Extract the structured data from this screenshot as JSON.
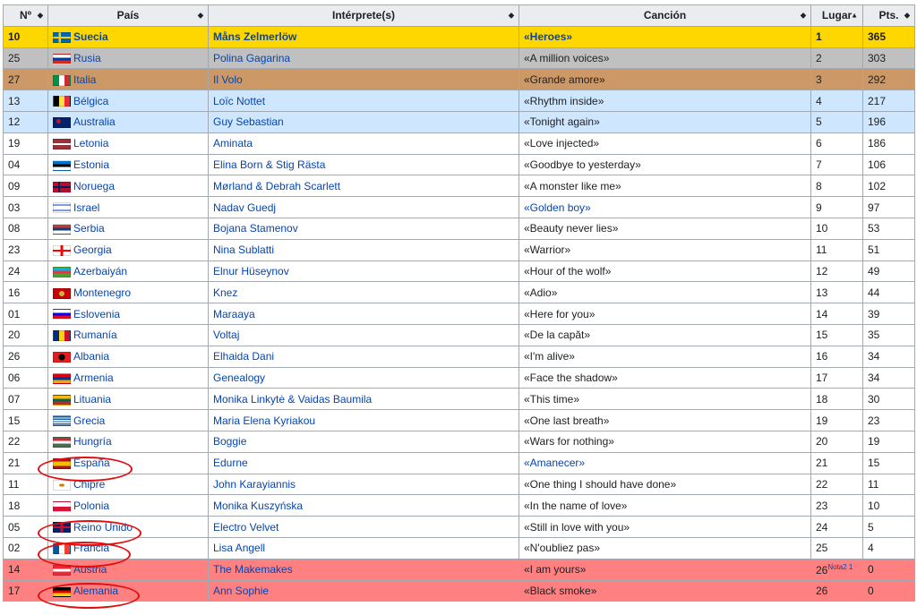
{
  "headers": {
    "no": "Nº",
    "pais": "País",
    "interprete": "Intérprete(s)",
    "cancion": "Canción",
    "lugar": "Lugar",
    "pts": "Pts."
  },
  "rows": [
    {
      "no": "10",
      "pais": "Suecia",
      "interprete": "Måns Zelmerlöw",
      "cancion": "«Heroes»",
      "lugar": "1",
      "pts": "365",
      "style": "gold",
      "flag": "se"
    },
    {
      "no": "25",
      "pais": "Rusia",
      "interprete": "Polina Gagarina",
      "cancion": "«A million voices»",
      "lugar": "2",
      "pts": "303",
      "style": "silver",
      "flag": "ru"
    },
    {
      "no": "27",
      "pais": "Italia",
      "interprete": "Il Volo",
      "cancion": "«Grande amore»",
      "lugar": "3",
      "pts": "292",
      "style": "bronze",
      "flag": "it"
    },
    {
      "no": "13",
      "pais": "Bélgica",
      "interprete": "Loïc Nottet",
      "cancion": "«Rhythm inside»",
      "lugar": "4",
      "pts": "217",
      "style": "blue",
      "flag": "be"
    },
    {
      "no": "12",
      "pais": "Australia",
      "interprete": "Guy Sebastian",
      "cancion": "«Tonight again»",
      "lugar": "5",
      "pts": "196",
      "style": "blue",
      "flag": "au"
    },
    {
      "no": "19",
      "pais": "Letonia",
      "interprete": "Aminata",
      "cancion": "«Love injected»",
      "lugar": "6",
      "pts": "186",
      "style": "white",
      "flag": "lv"
    },
    {
      "no": "04",
      "pais": "Estonia",
      "interprete": "Elina Born & Stig Rästa",
      "cancion": "«Goodbye to yesterday»",
      "lugar": "7",
      "pts": "106",
      "style": "white",
      "flag": "ee"
    },
    {
      "no": "09",
      "pais": "Noruega",
      "interprete": "Mørland & Debrah Scarlett",
      "cancion": "«A monster like me»",
      "lugar": "8",
      "pts": "102",
      "style": "white",
      "flag": "no"
    },
    {
      "no": "03",
      "pais": "Israel",
      "interprete": "Nadav Guedj",
      "cancion": "«Golden boy»",
      "lugar": "9",
      "pts": "97",
      "style": "white",
      "flag": "il",
      "songlink": true
    },
    {
      "no": "08",
      "pais": "Serbia",
      "interprete": "Bojana Stamenov",
      "cancion": "«Beauty never lies»",
      "lugar": "10",
      "pts": "53",
      "style": "white",
      "flag": "rs"
    },
    {
      "no": "23",
      "pais": "Georgia",
      "interprete": "Nina Sublatti",
      "cancion": "«Warrior»",
      "lugar": "11",
      "pts": "51",
      "style": "white",
      "flag": "ge"
    },
    {
      "no": "24",
      "pais": "Azerbaiyán",
      "interprete": "Elnur Hüseynov",
      "cancion": "«Hour of the wolf»",
      "lugar": "12",
      "pts": "49",
      "style": "white",
      "flag": "az"
    },
    {
      "no": "16",
      "pais": "Montenegro",
      "interprete": "Knez",
      "cancion": "«Adio»",
      "lugar": "13",
      "pts": "44",
      "style": "white",
      "flag": "me"
    },
    {
      "no": "01",
      "pais": "Eslovenia",
      "interprete": "Maraaya",
      "cancion": "«Here for you»",
      "lugar": "14",
      "pts": "39",
      "style": "white",
      "flag": "si"
    },
    {
      "no": "20",
      "pais": "Rumanía",
      "interprete": "Voltaj",
      "cancion": "«De la capăt»",
      "lugar": "15",
      "pts": "35",
      "style": "white",
      "flag": "ro"
    },
    {
      "no": "26",
      "pais": "Albania",
      "interprete": "Elhaida Dani",
      "cancion": "«I'm alive»",
      "lugar": "16",
      "pts": "34",
      "style": "white",
      "flag": "al"
    },
    {
      "no": "06",
      "pais": "Armenia",
      "interprete": "Genealogy",
      "cancion": "«Face the shadow»",
      "lugar": "17",
      "pts": "34",
      "style": "white",
      "flag": "am"
    },
    {
      "no": "07",
      "pais": "Lituania",
      "interprete": "Monika Linkytė & Vaidas Baumila",
      "cancion": "«This time»",
      "lugar": "18",
      "pts": "30",
      "style": "white",
      "flag": "lt"
    },
    {
      "no": "15",
      "pais": "Grecia",
      "interprete": "Maria Elena Kyriakou",
      "cancion": "«One last breath»",
      "lugar": "19",
      "pts": "23",
      "style": "white",
      "flag": "gr"
    },
    {
      "no": "22",
      "pais": "Hungría",
      "interprete": "Boggie",
      "cancion": "«Wars for nothing»",
      "lugar": "20",
      "pts": "19",
      "style": "white",
      "flag": "hu"
    },
    {
      "no": "21",
      "pais": "España",
      "interprete": "Edurne",
      "cancion": "«Amanecer»",
      "lugar": "21",
      "pts": "15",
      "style": "white",
      "flag": "es",
      "songlink": true
    },
    {
      "no": "11",
      "pais": "Chipre",
      "interprete": "John Karayiannis",
      "cancion": "«One thing I should have done»",
      "lugar": "22",
      "pts": "11",
      "style": "white",
      "flag": "cy"
    },
    {
      "no": "18",
      "pais": "Polonia",
      "interprete": "Monika Kuszyńska",
      "cancion": "«In the name of love»",
      "lugar": "23",
      "pts": "10",
      "style": "white",
      "flag": "pl"
    },
    {
      "no": "05",
      "pais": "Reino Unido",
      "interprete": "Electro Velvet",
      "cancion": "«Still in love with you»",
      "lugar": "24",
      "pts": "5",
      "style": "white",
      "flag": "gb"
    },
    {
      "no": "02",
      "pais": "Francia",
      "interprete": "Lisa Angell",
      "cancion": "«N'oubliez pas»",
      "lugar": "25",
      "pts": "4",
      "style": "white",
      "flag": "fr"
    },
    {
      "no": "14",
      "pais": "Austria",
      "interprete": "The Makemakes",
      "cancion": "«I am yours»",
      "lugar": "26",
      "lugar_note": "Nota2 1",
      "pts": "0",
      "style": "red",
      "flag": "at"
    },
    {
      "no": "17",
      "pais": "Alemania",
      "interprete": "Ann Sophie",
      "cancion": "«Black smoke»",
      "lugar": "26",
      "pts": "0",
      "style": "red",
      "flag": "de"
    }
  ],
  "colors": {
    "gold": "#ffd700",
    "silver": "#c0c0c0",
    "bronze": "#cc9966",
    "blue": "#cfe6ff",
    "red": "#fe8080",
    "link": "#0645ad",
    "annotation": "#e01010"
  }
}
